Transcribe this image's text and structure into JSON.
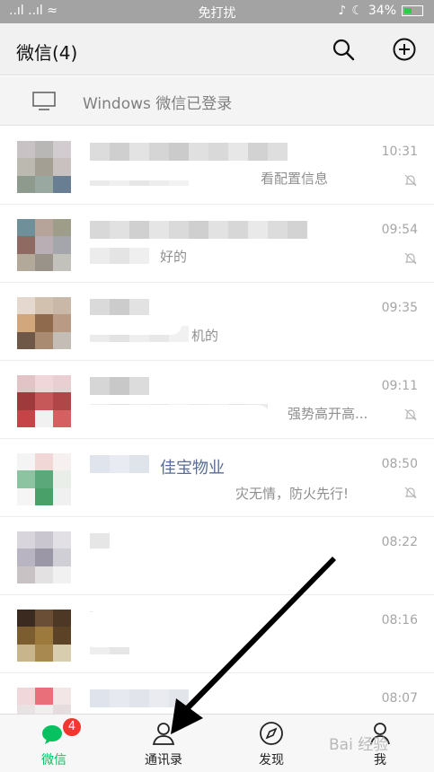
{
  "status_bar": {
    "signal": "..ıl ..ıl ≈",
    "mode": "免打扰",
    "battery": "34%"
  },
  "header": {
    "title": "微信(4)",
    "search_icon": "search-icon",
    "add_icon": "plus-circle-icon"
  },
  "login_notice": {
    "icon": "monitor-icon",
    "text": "Windows 微信已登录"
  },
  "chats": [
    {
      "time": "10:31",
      "muted": true,
      "visible_preview": "看配置信息"
    },
    {
      "time": "09:54",
      "muted": true,
      "visible_preview": "好的"
    },
    {
      "time": "09:35",
      "muted": false,
      "visible_preview": "机的"
    },
    {
      "time": "09:11",
      "muted": true,
      "visible_preview": "强势高开高..."
    },
    {
      "time": "08:50",
      "muted": true,
      "visible_name": "佳宝物业",
      "visible_preview": "灾无情，防火先行!"
    },
    {
      "time": "08:22",
      "muted": false,
      "visible_preview": ""
    },
    {
      "time": "08:16",
      "muted": false,
      "visible_preview": ""
    },
    {
      "time": "08:07",
      "muted": false,
      "visible_preview": ""
    }
  ],
  "tabs": [
    {
      "label": "微信",
      "icon": "chat-bubble-icon",
      "active": true,
      "badge": "4"
    },
    {
      "label": "通讯录",
      "icon": "contacts-icon",
      "active": false
    },
    {
      "label": "发现",
      "icon": "compass-icon",
      "active": false
    },
    {
      "label": "我",
      "icon": "person-icon",
      "active": false
    }
  ],
  "watermark": "Bai 经验",
  "colors": {
    "accent": "#07c160",
    "badge": "#f43530",
    "status_bar": "#a3a3a3"
  }
}
